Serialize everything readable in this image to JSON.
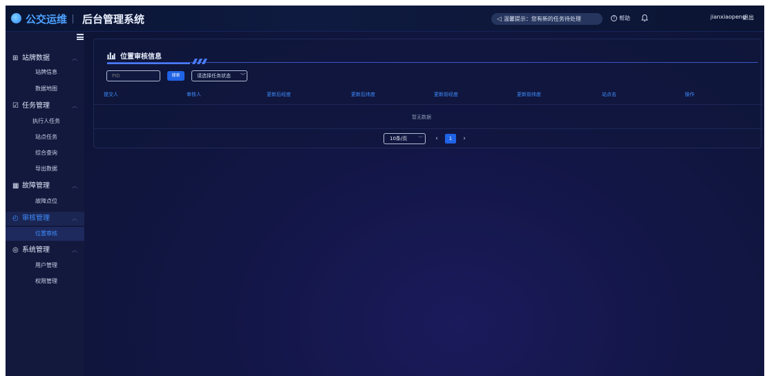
{
  "header": {
    "brand": "公交运维",
    "system_title": "后台管理系统",
    "notice": "温馨提示：您有新的任务待处理",
    "help": "帮助",
    "username": "jianxiaopeng",
    "logout": "退出"
  },
  "sidebar": {
    "groups": [
      {
        "label": "站牌数据",
        "icon": "signboard-icon",
        "items": [
          "站牌信息",
          "数据地图"
        ]
      },
      {
        "label": "任务管理",
        "icon": "task-icon",
        "items": [
          "执行人任务",
          "站点任务",
          "综合查询",
          "导出数据"
        ]
      },
      {
        "label": "故障管理",
        "icon": "fault-icon",
        "items": [
          "故障点位"
        ]
      },
      {
        "label": "审核管理",
        "icon": "audit-icon",
        "active": true,
        "items": [
          "位置审核"
        ]
      },
      {
        "label": "系统管理",
        "icon": "system-icon",
        "items": [
          "用户管理",
          "权限管理"
        ]
      }
    ],
    "active_item": "位置审核"
  },
  "panel": {
    "title": "位置审核信息",
    "search": {
      "placeholder": "PID",
      "button_label": "搜索",
      "status_placeholder": "请选择任务状态"
    },
    "table": {
      "columns": [
        "提交人",
        "审核人",
        "更新后经度",
        "更新后纬度",
        "更新前经度",
        "更新前纬度",
        "站点名",
        "操作"
      ],
      "rows": [],
      "empty_text": "暂无数据"
    },
    "pagination": {
      "page_size": "10条/页",
      "current_page": "1"
    }
  },
  "colors": {
    "accent": "#3f8dff",
    "background": "#0c1430",
    "sidebar": "#13193d",
    "button": "#1f63e6"
  }
}
